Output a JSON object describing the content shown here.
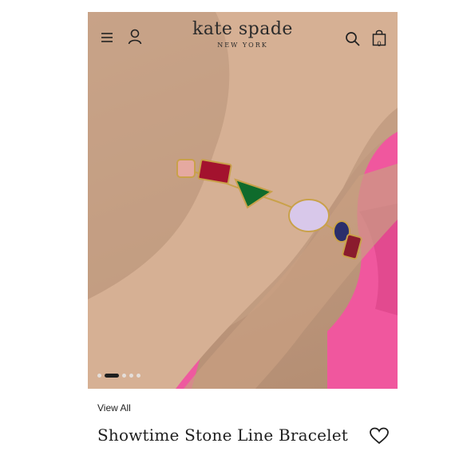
{
  "header": {
    "brand": "kate spade",
    "brand_sub": "NEW YORK",
    "cart_count": "0",
    "icons": [
      "menu-icon",
      "account-icon",
      "search-icon",
      "shopping-bag-icon"
    ]
  },
  "gallery": {
    "image": "model-wearing-bracelet",
    "slide_count": 5,
    "active_slide": 2
  },
  "product": {
    "breadcrumb_link": "View All",
    "title": "Showtime Stone Line Bracelet",
    "wishlist_icon": "heart-icon"
  },
  "colors": {
    "accent_pink": "#f0579e",
    "text": "#222222"
  }
}
